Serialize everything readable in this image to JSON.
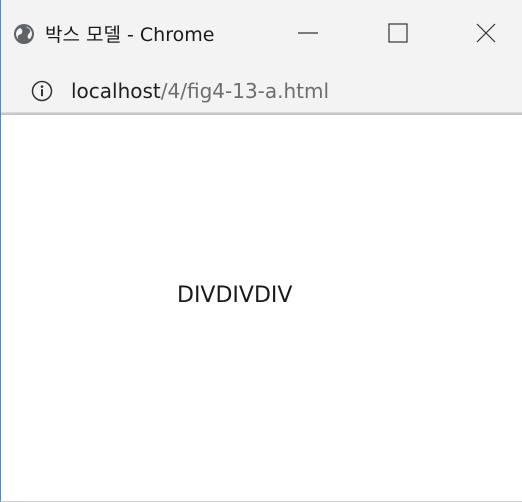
{
  "window": {
    "title": "박스 모델 - Chrome"
  },
  "addressbar": {
    "host": "localhost",
    "path": "/4/fig4-13-a.html"
  },
  "page": {
    "divs": [
      "DIV",
      "DIV",
      "DIV"
    ]
  },
  "icons": {
    "page_icon": "globe-icon",
    "info": "info-icon",
    "minimize": "minimize-icon",
    "maximize": "maximize-icon",
    "close": "close-icon"
  },
  "colors": {
    "chrome_bg": "#f3f3f3",
    "window_border": "#3a8ee6",
    "text": "#1a1a1a",
    "url_path": "#6e6e6e"
  }
}
